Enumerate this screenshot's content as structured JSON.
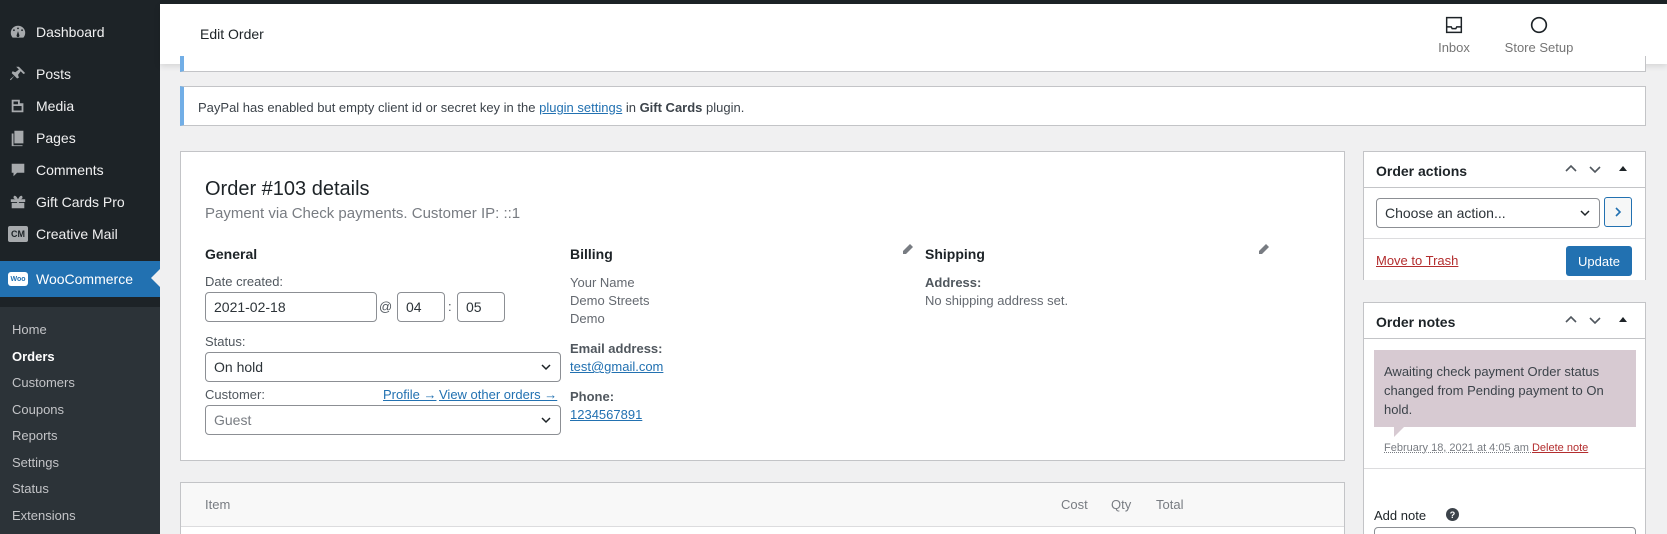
{
  "sidebar": {
    "items": [
      {
        "label": "Dashboard",
        "icon": "dashboard-icon"
      },
      {
        "label": "Posts",
        "icon": "pin-icon"
      },
      {
        "label": "Media",
        "icon": "media-icon"
      },
      {
        "label": "Pages",
        "icon": "pages-icon"
      },
      {
        "label": "Comments",
        "icon": "comment-icon"
      },
      {
        "label": "Gift Cards Pro",
        "icon": "gift-cards-icon"
      },
      {
        "label": "Creative Mail",
        "icon": "creative-mail-icon",
        "badge": "CM"
      },
      {
        "label": "WooCommerce",
        "icon": "woocommerce-icon",
        "badge": "Woo"
      }
    ],
    "submenu": [
      "Home",
      "Orders",
      "Customers",
      "Coupons",
      "Reports",
      "Settings",
      "Status",
      "Extensions"
    ],
    "accent": "#2271b1",
    "background": "#1d2327"
  },
  "header": {
    "title": "Edit Order",
    "inbox_label": "Inbox",
    "store_setup_label": "Store Setup"
  },
  "notice": {
    "prefix": "PayPal has enabled but empty client id or secret key in the ",
    "link": "plugin settings",
    "middle": " in ",
    "bold": "Gift Cards",
    "suffix": " plugin."
  },
  "order": {
    "heading": "Order #103 details",
    "subheading": "Payment via Check payments. Customer IP: ::1",
    "general": {
      "title": "General",
      "date_label": "Date created:",
      "date": "2021-02-18",
      "at": "@",
      "hour": "04",
      "colon": ":",
      "minute": "05",
      "status_label": "Status:",
      "status": "On hold",
      "customer_label": "Customer:",
      "profile_link": "Profile →",
      "other_orders_link": "View other orders →",
      "customer": "Guest"
    },
    "billing": {
      "title": "Billing",
      "address_lines": [
        "Your Name",
        "Demo Streets",
        "Demo"
      ],
      "email_label": "Email address:",
      "email": "test@gmail.com",
      "phone_label": "Phone:",
      "phone": "1234567891"
    },
    "shipping": {
      "title": "Shipping",
      "address_label": "Address:",
      "address": "No shipping address set."
    }
  },
  "items_table": {
    "columns": [
      "Item",
      "Cost",
      "Qty",
      "Total"
    ]
  },
  "order_actions": {
    "title": "Order actions",
    "select_value": "Choose an action...",
    "move_to_trash": "Move to Trash",
    "update": "Update"
  },
  "order_notes": {
    "title": "Order notes",
    "note_text": "Awaiting check payment Order status changed from Pending payment to On hold.",
    "note_date": "February 18, 2021 at 4:05 am",
    "delete_link": "Delete note",
    "add_note_label": "Add note",
    "help": "?"
  }
}
